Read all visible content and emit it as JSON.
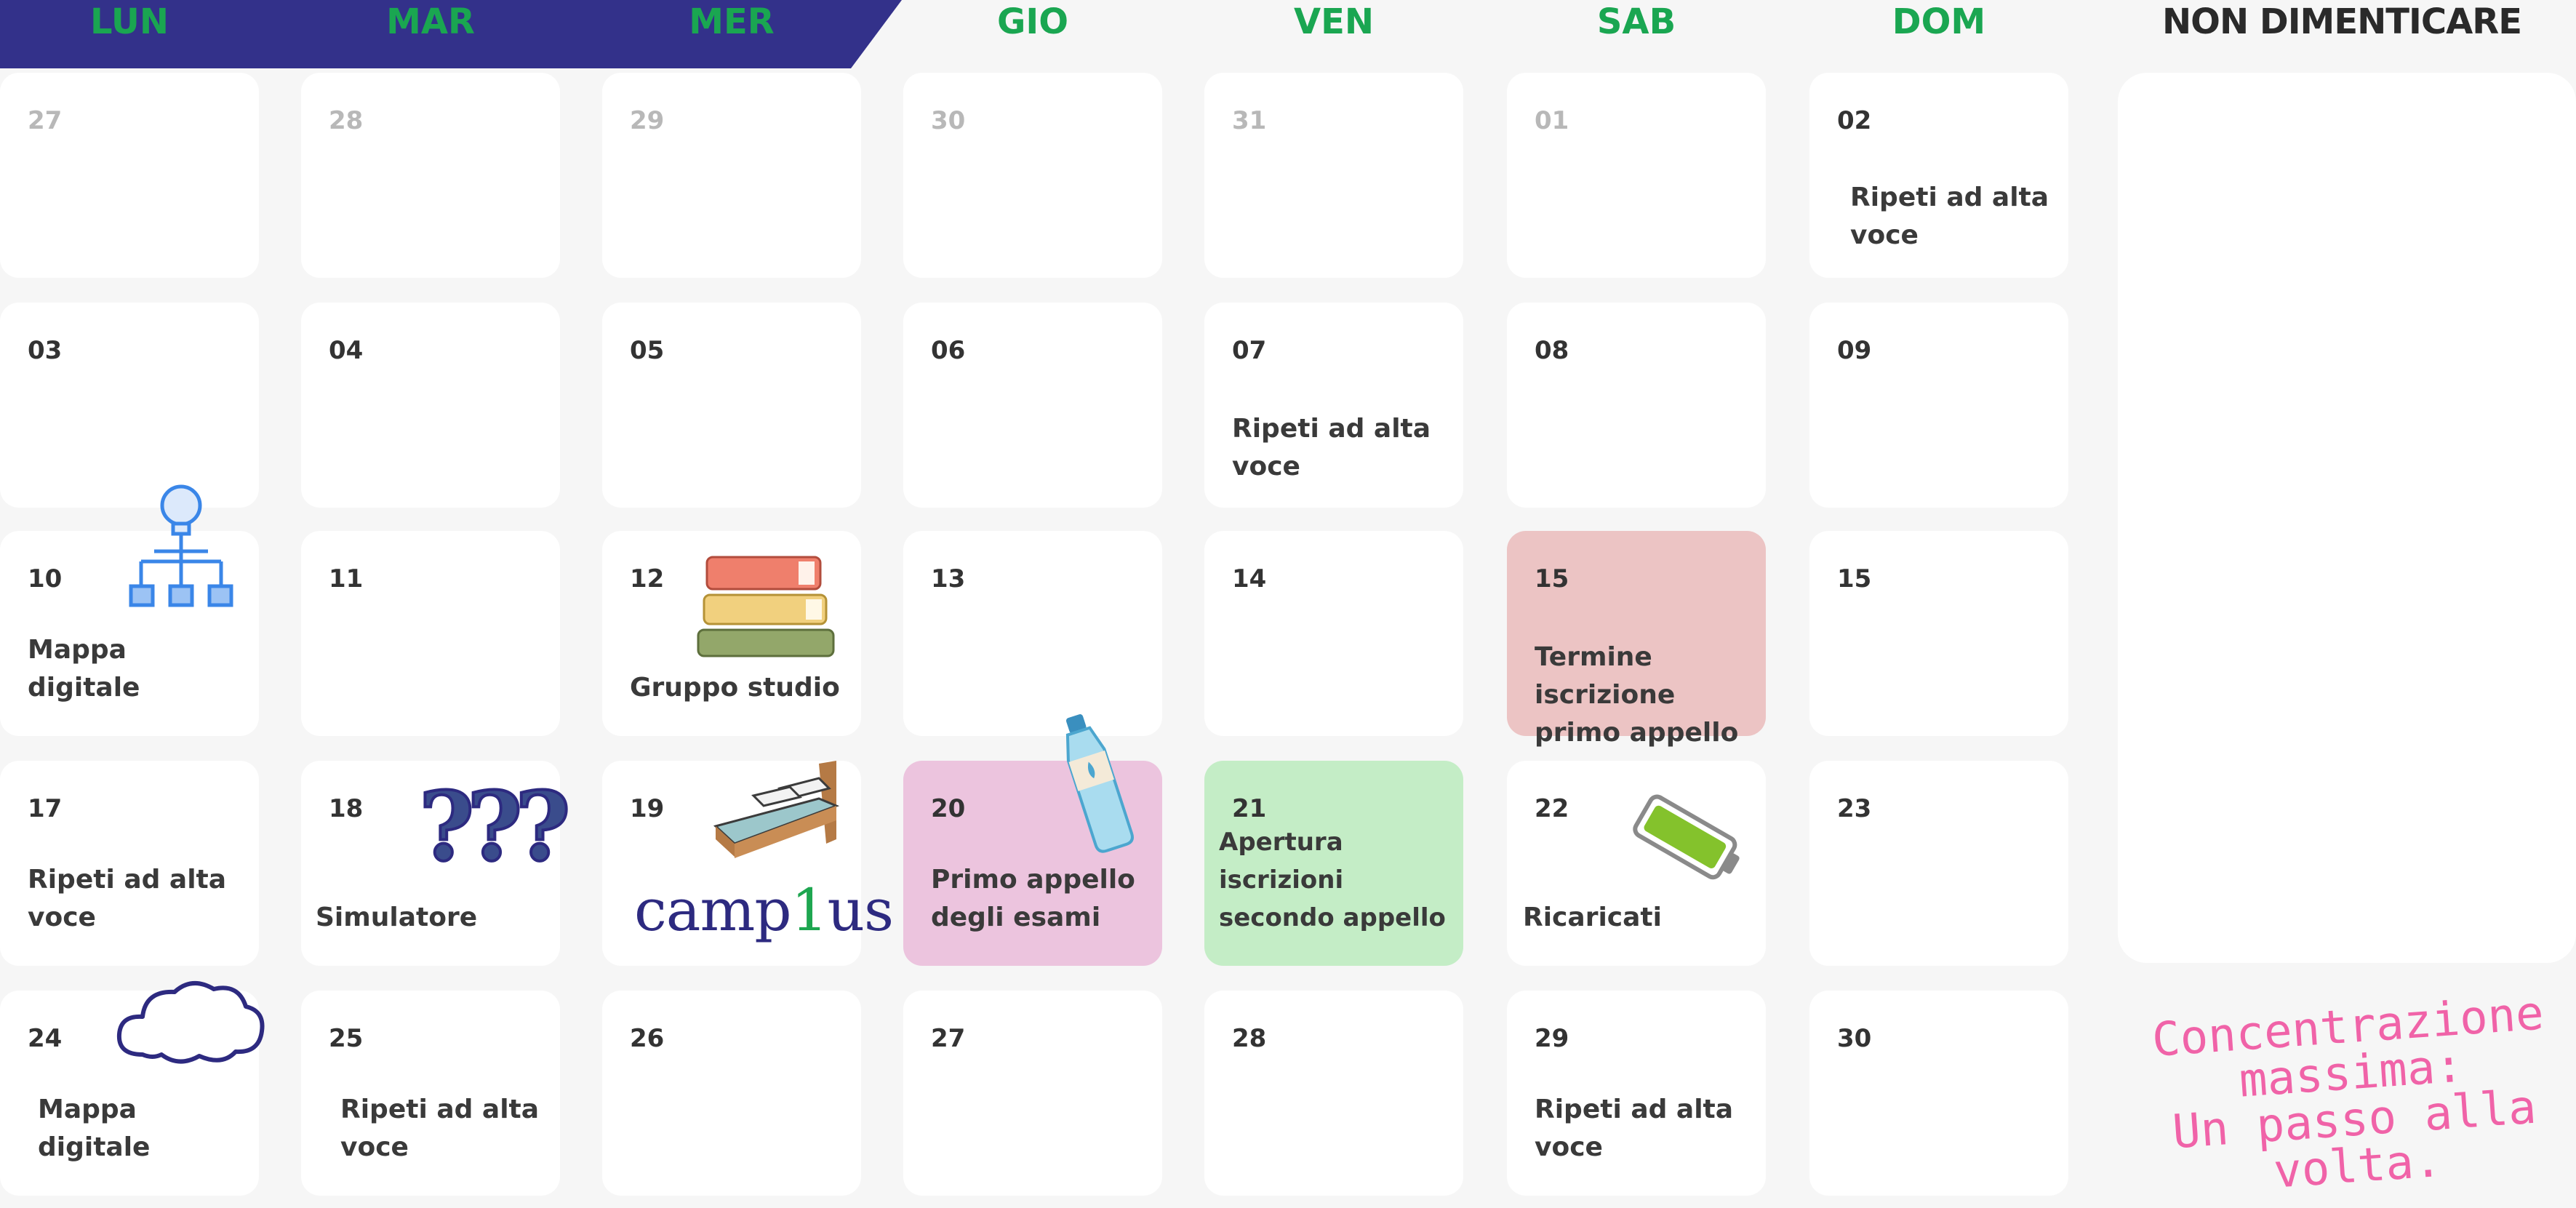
{
  "weekdays": [
    "LUN",
    "MAR",
    "MER",
    "GIO",
    "VEN",
    "SAB",
    "DOM"
  ],
  "notes_title": "NON DIMENTICARE",
  "quote": [
    "Concentrazione",
    "massima:",
    "Un passo alla",
    "volta."
  ],
  "brand": {
    "a": "camp",
    "b": "1",
    "c": "us"
  },
  "colors": {
    "banner": "#33318a",
    "weekday": "#1aa651",
    "red_cell": "#ecc4c4",
    "pink_cell": "#ecc4de",
    "green_cell": "#c4edc6",
    "quote": "#f063a8"
  },
  "weeks": [
    [
      {
        "num": "27",
        "past": true
      },
      {
        "num": "28",
        "past": true
      },
      {
        "num": "29",
        "past": true
      },
      {
        "num": "30",
        "past": true
      },
      {
        "num": "31",
        "past": true
      },
      {
        "num": "01",
        "past": true
      },
      {
        "num": "02",
        "text": "Ripeti ad alta voce"
      }
    ],
    [
      {
        "num": "03"
      },
      {
        "num": "04"
      },
      {
        "num": "05"
      },
      {
        "num": "06"
      },
      {
        "num": "07",
        "text": "Ripeti ad alta voce"
      },
      {
        "num": "08"
      },
      {
        "num": "09"
      }
    ],
    [
      {
        "num": "10",
        "text": "Mappa digitale",
        "icon": "lightbulb-diagram-icon"
      },
      {
        "num": "11"
      },
      {
        "num": "12",
        "text": "Gruppo studio",
        "icon": "books-icon"
      },
      {
        "num": "13",
        "icon": "water-bottle-icon"
      },
      {
        "num": "14"
      },
      {
        "num": "15",
        "text": "Termine iscrizione primo appello",
        "color": "red"
      },
      {
        "num": "15"
      }
    ],
    [
      {
        "num": "17",
        "text": "Ripeti ad alta voce"
      },
      {
        "num": "18",
        "text": "Simulatore",
        "icon": "question-marks-icon"
      },
      {
        "num": "19",
        "icon": "bed-icon"
      },
      {
        "num": "20",
        "text": "Primo appello degli esami",
        "color": "pink"
      },
      {
        "num": "21",
        "text": "Apertura iscrizioni secondo appello",
        "color": "green"
      },
      {
        "num": "22",
        "text": "Ricaricati",
        "icon": "battery-icon"
      },
      {
        "num": "23"
      }
    ],
    [
      {
        "num": "24",
        "text": "Mappa digitale",
        "icon": "cloud-icon"
      },
      {
        "num": "25",
        "text": "Ripeti ad alta voce"
      },
      {
        "num": "26"
      },
      {
        "num": "27"
      },
      {
        "num": "28"
      },
      {
        "num": "29",
        "text": "Ripeti ad alta voce"
      },
      {
        "num": "30"
      }
    ]
  ]
}
